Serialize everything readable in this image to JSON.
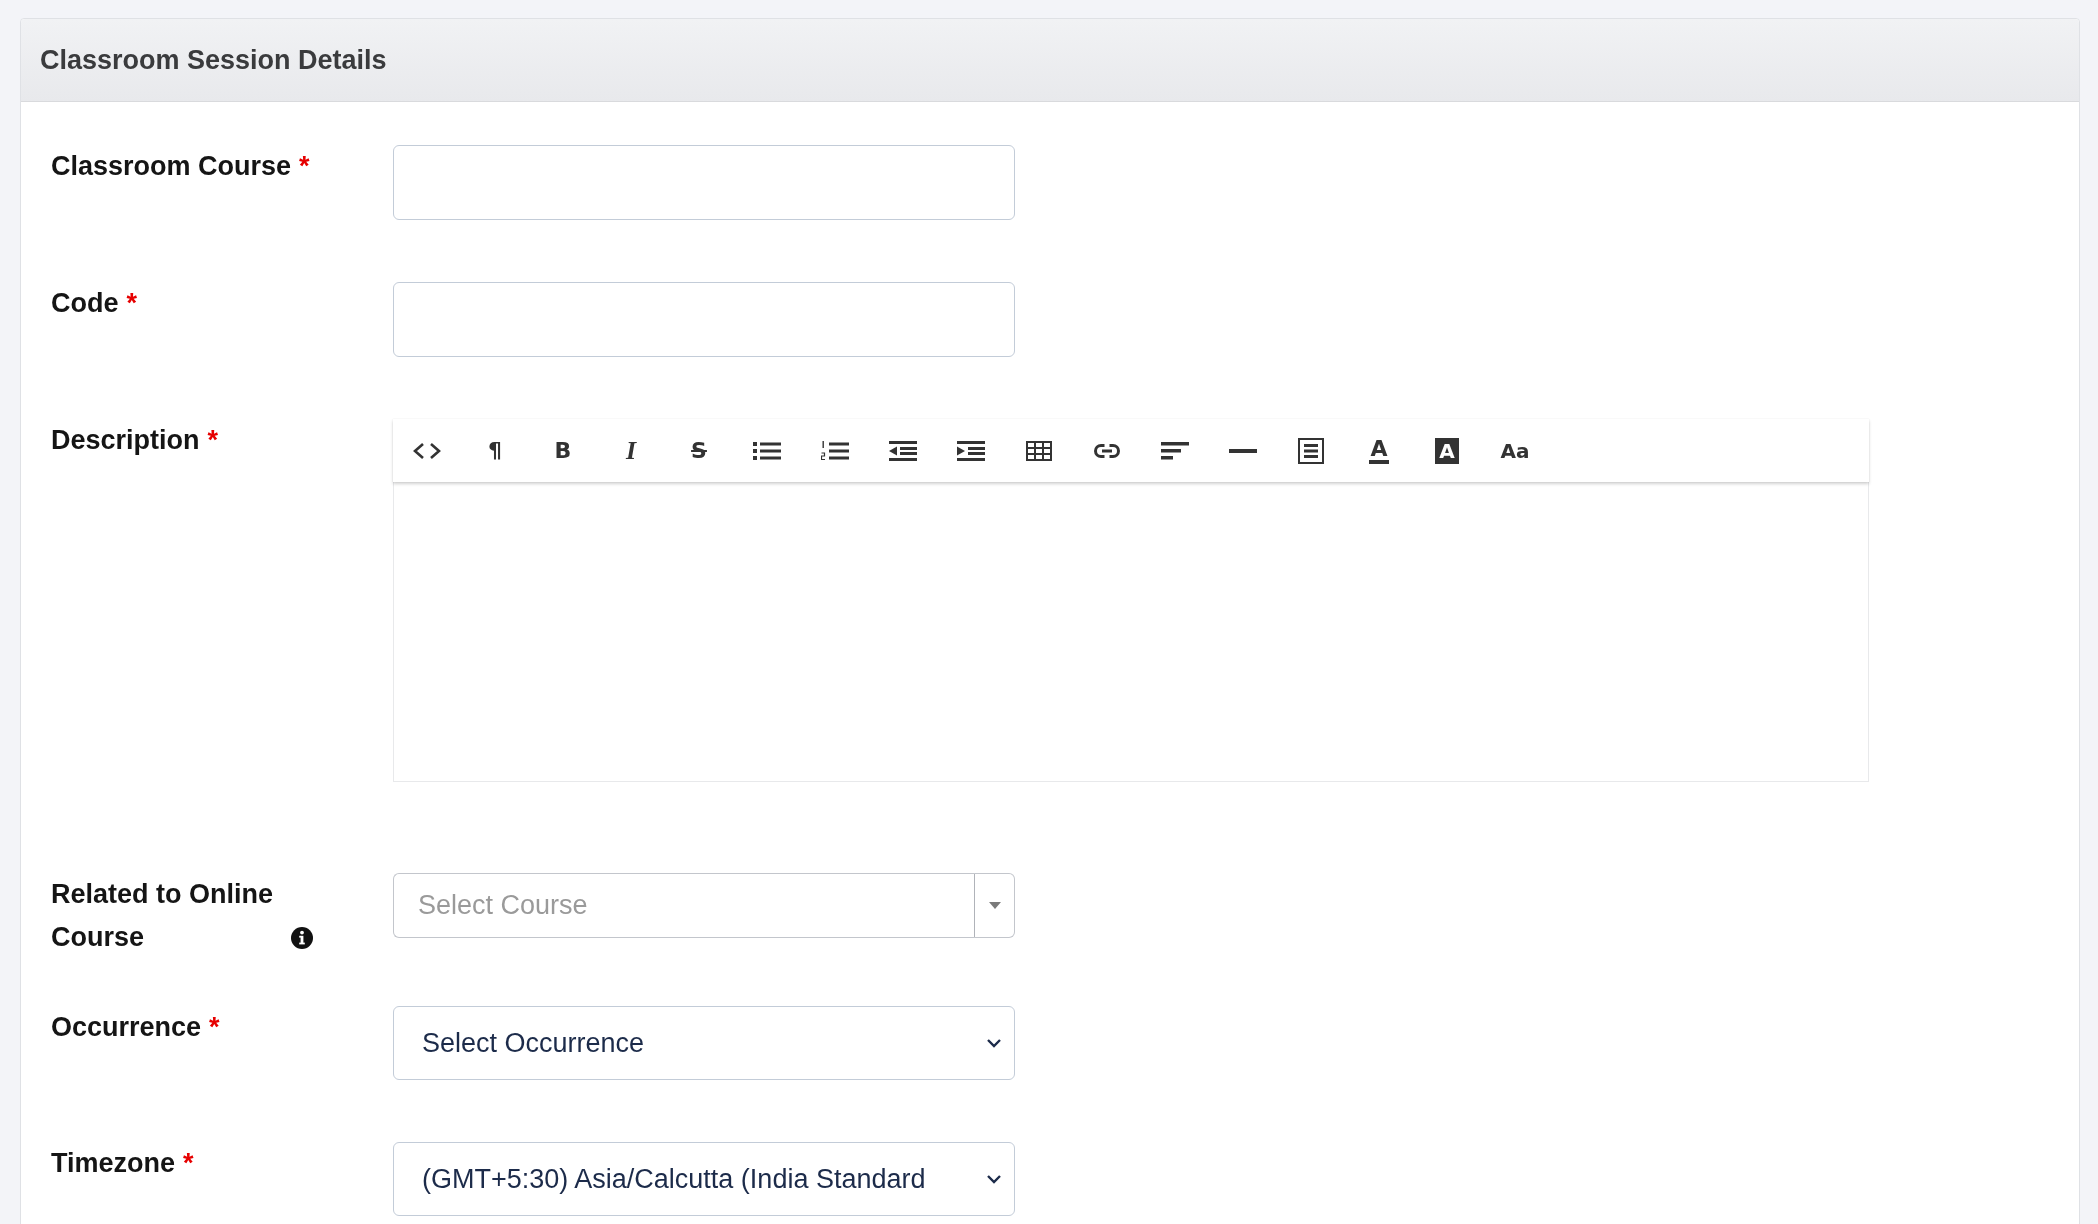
{
  "panel": {
    "title": "Classroom Session Details",
    "fields": [
      {
        "kind": "text",
        "label": "Classroom Course",
        "required_mark": "*",
        "info": false
      },
      {
        "kind": "text",
        "label": "Code",
        "required_mark": "*",
        "info": false
      },
      {
        "kind": "editor",
        "label": "Description",
        "required_mark": "*",
        "info": false,
        "toolbar": [
          {
            "kind": "code"
          },
          {
            "kind": "paragraph",
            "glyph": "¶"
          },
          {
            "kind": "bold",
            "glyph": "B"
          },
          {
            "kind": "italic",
            "glyph": "I"
          },
          {
            "kind": "strikethrough",
            "glyph": "S"
          },
          {
            "kind": "bullet-list"
          },
          {
            "kind": "numbered-list"
          },
          {
            "kind": "outdent"
          },
          {
            "kind": "indent"
          },
          {
            "kind": "table"
          },
          {
            "kind": "link"
          },
          {
            "kind": "align"
          },
          {
            "kind": "horizontal-rule"
          },
          {
            "kind": "block"
          },
          {
            "kind": "text-color",
            "glyph": "A"
          },
          {
            "kind": "highlight",
            "glyph": "A"
          },
          {
            "kind": "font-size",
            "glyph": "Aa"
          }
        ]
      },
      {
        "kind": "combo",
        "label": "Related to Online Course",
        "info": true,
        "placeholder": "Select Course"
      },
      {
        "kind": "select",
        "label": "Occurrence",
        "required_mark": "*",
        "info": false,
        "value": "Select Occurrence"
      },
      {
        "kind": "select",
        "label": "Timezone",
        "required_mark": "*",
        "info": false,
        "value": "(GMT+5:30) Asia/Calcutta (India Standard"
      }
    ]
  }
}
